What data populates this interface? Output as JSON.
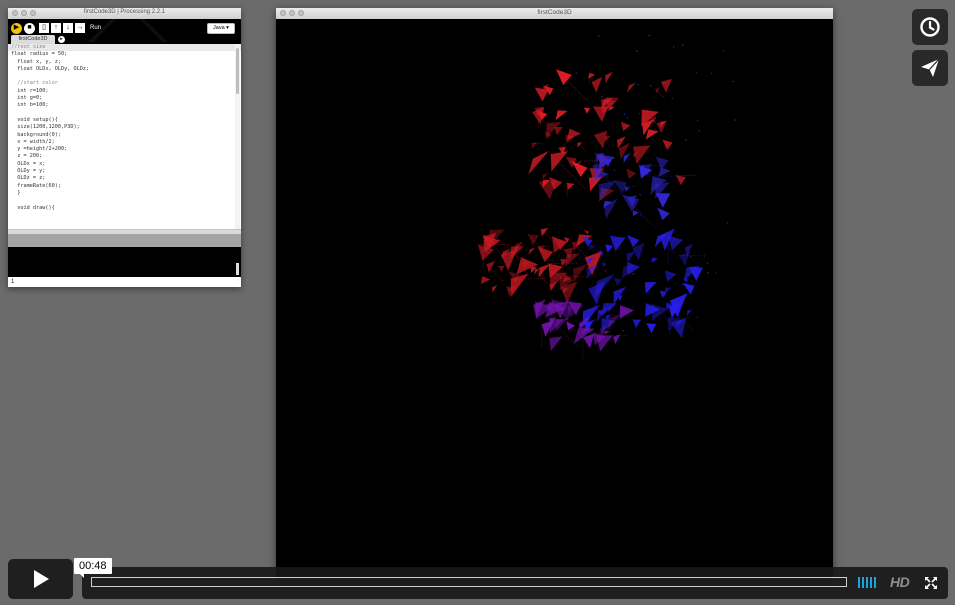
{
  "ide": {
    "title": "firstCode3D | Processing 2.2.1",
    "run_label": "Run",
    "mode_label": "Java ▾",
    "tab_label": "firstCode3D",
    "code_lines": [
      "//root size",
      "float radius = 50;",
      "  float x, y, z;",
      "  float OLDx, OLDy, OLDz;",
      "",
      "  //start color",
      "  int r=100;",
      "  int g=0;",
      "  int b=100;",
      "",
      "  void setup(){",
      "  size(1200,1200,P3D);",
      "  background(0);",
      "  x = width/2;",
      "  y =height/2+200;",
      "  z = 200;",
      "  OLDx = x;",
      "  OLDy = y;",
      "  OLDz = z;",
      "  frameRate(60);",
      "  }",
      "",
      "  void draw(){"
    ],
    "status_line": "1"
  },
  "sketch": {
    "title": "firstCode3D"
  },
  "player": {
    "current_time": "00:48",
    "hd_label": "HD"
  },
  "icons": {
    "watch_later": "clock-icon",
    "share": "paper-plane-icon",
    "play": "play-icon",
    "volume": "volume-bars-icon",
    "fullscreen": "fullscreen-icon"
  },
  "colors": {
    "accent": "#19a3e0",
    "run_button": "#f2c400",
    "control_bg": "#171717"
  }
}
